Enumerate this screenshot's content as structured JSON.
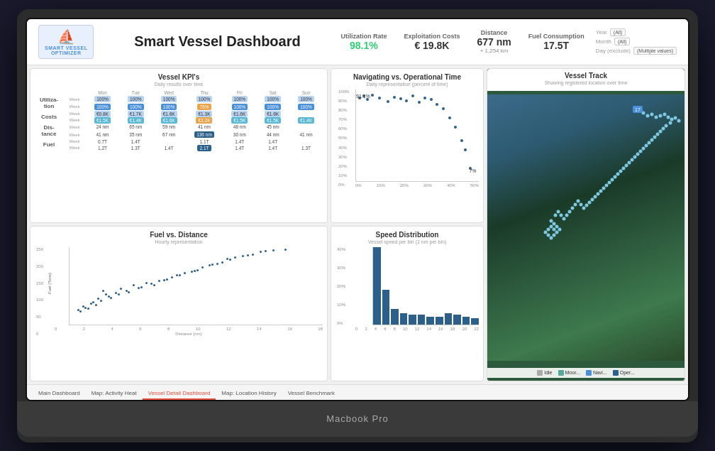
{
  "laptop": {
    "label": "Macbook Pro"
  },
  "header": {
    "title": "Smart Vessel Dashboard",
    "logo_lines": [
      "SMART VESSEL",
      "OPTIMIZER"
    ],
    "kpis": [
      {
        "label": "Utilization Rate",
        "value": "98.1%",
        "color": "green",
        "sub": ""
      },
      {
        "label": "Exploitation Costs",
        "value": "€ 19.8K",
        "color": "normal",
        "sub": ""
      },
      {
        "label": "Distance",
        "value": "677 nm",
        "color": "normal",
        "sub": "+ 1,254 km"
      },
      {
        "label": "Fuel Consumption",
        "value": "17.5T",
        "color": "normal",
        "sub": ""
      }
    ],
    "filters": [
      {
        "label": "Year",
        "value": "(All)"
      },
      {
        "label": "Month",
        "value": "(All)"
      },
      {
        "label": "Day (exclude)",
        "value": "(Multiple values)"
      }
    ]
  },
  "panels": {
    "vessel_kpis": {
      "title": "Vessel KPI's",
      "subtitle": "Daily results over time",
      "row_labels": [
        "Utiliza-tion",
        "Costs",
        "Dis-tance",
        "Fuel"
      ],
      "col_headers": [
        "Mon",
        "Tue",
        "Wed",
        "Thu",
        "Fri",
        "Sat",
        "Sun"
      ],
      "rows": [
        {
          "label": "Utiliza-tion",
          "week_row": [
            "100%",
            "100%",
            "100%",
            "100%",
            "100%",
            "100%",
            "100%"
          ],
          "week2_row": [
            "100%",
            "100%",
            "100%",
            "76%",
            "100%",
            "100%",
            "100%"
          ]
        },
        {
          "label": "Costs",
          "week_row": [
            "€0.8K",
            "€1.7K",
            "€1.6K",
            "€1.3K",
            "€1.6K",
            "€1.6K"
          ],
          "week2_row": [
            "€1.5K",
            "€1.4K",
            "€1.6K",
            "€2.2K",
            "€1.5K",
            "€1.5K",
            "€1.4K"
          ]
        },
        {
          "label": "Dis-tance",
          "week_row": [
            "24 nm",
            "65 nm",
            "59 nm",
            "41 nm",
            "48 nm",
            "45 nm"
          ],
          "week2_row": [
            "41 nm",
            "35 nm",
            "67 nm",
            "136 nm",
            "30 nm",
            "44 nm",
            "41 nm"
          ]
        },
        {
          "label": "Fuel",
          "week_row": [
            "0.7T",
            "1.4T",
            "",
            "1.1T",
            "1.4T",
            "1.4T"
          ],
          "week2_row": [
            "1.2T",
            "1.3T",
            "1.4T",
            "2.1T",
            "1.4T",
            "1.4T",
            "1.3T"
          ]
        }
      ]
    },
    "navigating": {
      "title": "Navigating vs. Operational Time",
      "subtitle": "Daily representation (percent of time)",
      "y_labels": [
        "100%",
        "90%",
        "80%",
        "70%",
        "60%",
        "50%",
        "40%",
        "30%",
        "20%",
        "10%",
        "0%"
      ],
      "x_labels": [
        "0%",
        "10%",
        "20%",
        "30%",
        "40%",
        "50%"
      ],
      "first_point": "91.1%",
      "last_point": "7%"
    },
    "vessel_track": {
      "title": "Vessel Track",
      "subtitle": "Showing registered location over time",
      "legend": [
        {
          "label": "Idle",
          "color": "#aaa"
        },
        {
          "label": "Moor...",
          "color": "#5a9"
        },
        {
          "label": "Navi...",
          "color": "#4a90d9"
        },
        {
          "label": "Oper...",
          "color": "#2c5f8a"
        }
      ]
    },
    "fuel_distance": {
      "title": "Fuel vs. Distance",
      "subtitle": "Hourly representation",
      "y_label": "Fuel (Tons)",
      "x_label": "Distance (nm)",
      "x_ticks": [
        "0",
        "2",
        "4",
        "6",
        "8",
        "10",
        "12",
        "14",
        "16",
        "18"
      ],
      "y_ticks": [
        "250",
        "200",
        "150",
        "100",
        "50",
        "0"
      ]
    },
    "speed_distribution": {
      "title": "Speed Distribution",
      "subtitle": "Vessel speed per bin (2 nm per bin)",
      "y_label_pct": [
        "40%",
        "30%",
        "20%",
        "10%",
        "0%"
      ],
      "x_ticks": [
        "0",
        "2",
        "4",
        "6",
        "8",
        "10",
        "12",
        "14",
        "16",
        "18",
        "20",
        "22"
      ],
      "bars": [
        0.4,
        0.18,
        0.08,
        0.06,
        0.05,
        0.05,
        0.04,
        0.04,
        0.06,
        0.05,
        0.04,
        0.03
      ]
    }
  },
  "tabs": [
    {
      "label": "Main Dashboard",
      "active": false
    },
    {
      "label": "Map: Activity Heat",
      "active": false
    },
    {
      "label": "Vessel Detail Dashboard",
      "active": true
    },
    {
      "label": "Map: Location History",
      "active": false
    },
    {
      "label": "Vessel Benchmark",
      "active": false
    }
  ]
}
